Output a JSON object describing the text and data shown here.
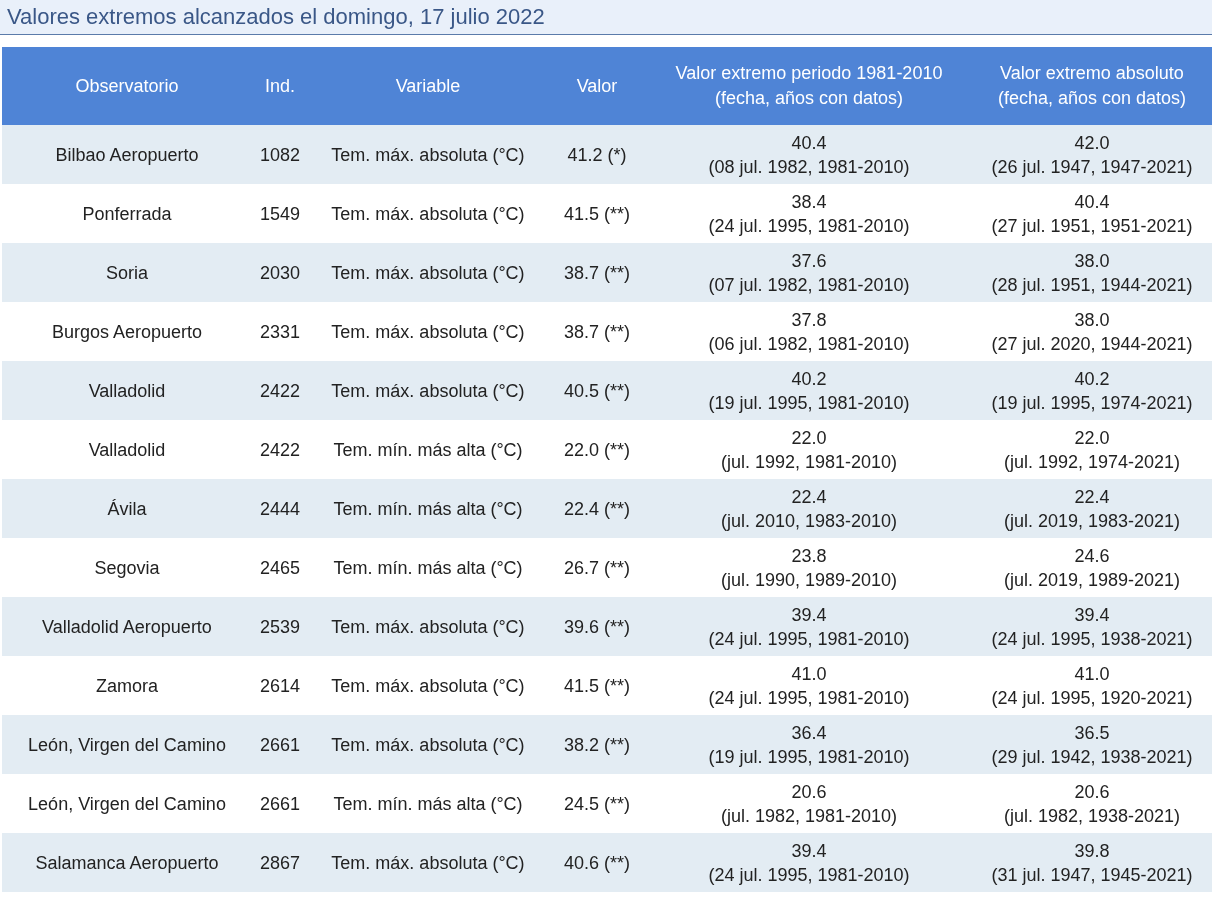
{
  "title": "Valores extremos alcanzados el domingo, 17 julio 2022",
  "table": {
    "columns": [
      "Observatorio",
      "Ind.",
      "Variable",
      "Valor",
      "Valor extremo periodo 1981-2010\n(fecha, años con datos)",
      "Valor extremo absoluto\n(fecha, años con datos)"
    ],
    "rows": [
      [
        "Bilbao Aeropuerto",
        "1082",
        "Tem. máx. absoluta (°C)",
        "41.2 (*)",
        "40.4\n(08 jul. 1982, 1981-2010)",
        "42.0\n(26 jul. 1947, 1947-2021)"
      ],
      [
        "Ponferrada",
        "1549",
        "Tem. máx. absoluta (°C)",
        "41.5 (**)",
        "38.4\n(24 jul. 1995, 1981-2010)",
        "40.4\n(27 jul. 1951, 1951-2021)"
      ],
      [
        "Soria",
        "2030",
        "Tem. máx. absoluta (°C)",
        "38.7 (**)",
        "37.6\n(07 jul. 1982, 1981-2010)",
        "38.0\n(28 jul. 1951, 1944-2021)"
      ],
      [
        "Burgos Aeropuerto",
        "2331",
        "Tem. máx. absoluta (°C)",
        "38.7 (**)",
        "37.8\n(06 jul. 1982, 1981-2010)",
        "38.0\n(27 jul. 2020, 1944-2021)"
      ],
      [
        "Valladolid",
        "2422",
        "Tem. máx. absoluta (°C)",
        "40.5 (**)",
        "40.2\n(19 jul. 1995, 1981-2010)",
        "40.2\n(19 jul. 1995, 1974-2021)"
      ],
      [
        "Valladolid",
        "2422",
        "Tem. mín. más alta (°C)",
        "22.0 (**)",
        "22.0\n(jul. 1992, 1981-2010)",
        "22.0\n(jul. 1992, 1974-2021)"
      ],
      [
        "Ávila",
        "2444",
        "Tem. mín. más alta (°C)",
        "22.4 (**)",
        "22.4\n(jul. 2010, 1983-2010)",
        "22.4\n(jul. 2019, 1983-2021)"
      ],
      [
        "Segovia",
        "2465",
        "Tem. mín. más alta (°C)",
        "26.7 (**)",
        "23.8\n(jul. 1990, 1989-2010)",
        "24.6\n(jul. 2019, 1989-2021)"
      ],
      [
        "Valladolid Aeropuerto",
        "2539",
        "Tem. máx. absoluta (°C)",
        "39.6 (**)",
        "39.4\n(24 jul. 1995, 1981-2010)",
        "39.4\n(24 jul. 1995, 1938-2021)"
      ],
      [
        "Zamora",
        "2614",
        "Tem. máx. absoluta (°C)",
        "41.5 (**)",
        "41.0\n(24 jul. 1995, 1981-2010)",
        "41.0\n(24 jul. 1995, 1920-2021)"
      ],
      [
        "León, Virgen del Camino",
        "2661",
        "Tem. máx. absoluta (°C)",
        "38.2 (**)",
        "36.4\n(19 jul. 1995, 1981-2010)",
        "36.5\n(29 jul. 1942, 1938-2021)"
      ],
      [
        "León, Virgen del Camino",
        "2661",
        "Tem. mín. más alta (°C)",
        "24.5 (**)",
        "20.6\n(jul. 1982, 1981-2010)",
        "20.6\n(jul. 1982, 1938-2021)"
      ],
      [
        "Salamanca Aeropuerto",
        "2867",
        "Tem. máx. absoluta (°C)",
        "40.6 (**)",
        "39.4\n(24 jul. 1995, 1981-2010)",
        "39.8\n(31 jul. 1947, 1945-2021)"
      ]
    ]
  }
}
